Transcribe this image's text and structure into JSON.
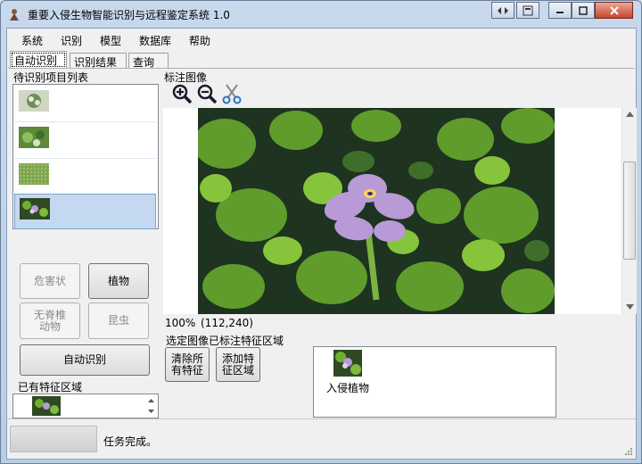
{
  "window": {
    "title": "重要入侵生物智能识别与远程鉴定系统 1.0"
  },
  "menu": [
    "系统",
    "识别",
    "模型",
    "数据库",
    "帮助"
  ],
  "tabs": [
    "自动识别",
    "识别结果",
    "查询"
  ],
  "left": {
    "list_title": "待识别项目列表",
    "items": [
      {
        "thumb": "plant-thumb-1"
      },
      {
        "thumb": "plant-thumb-2"
      },
      {
        "thumb": "plant-thumb-3"
      },
      {
        "thumb": "water-hyacinth-thumb",
        "selected": true
      }
    ],
    "buttons": {
      "damage": "危害状",
      "plant": "植物",
      "invertebrate": "无脊椎动物",
      "insect": "昆虫",
      "auto": "自动识别"
    },
    "existing_title": "已有特征区域"
  },
  "right": {
    "image_title": "标注图像",
    "tool_icons": [
      "zoom-in-icon",
      "zoom-out-icon",
      "scissors-icon"
    ],
    "zoom": "100%",
    "coord": "(112,240)",
    "selected_title": "选定图像已标注特征区域",
    "clear_btn": "清除所有特征",
    "add_btn": "添加特征区域",
    "feature_label": "入侵植物"
  },
  "status": {
    "message": "任务完成。"
  },
  "colors": {
    "selection": "#c4d8ef",
    "title_gradient": "#c9d9ec",
    "leaf_green": "#5f9c2c",
    "flower_purple": "#b79ad6"
  }
}
